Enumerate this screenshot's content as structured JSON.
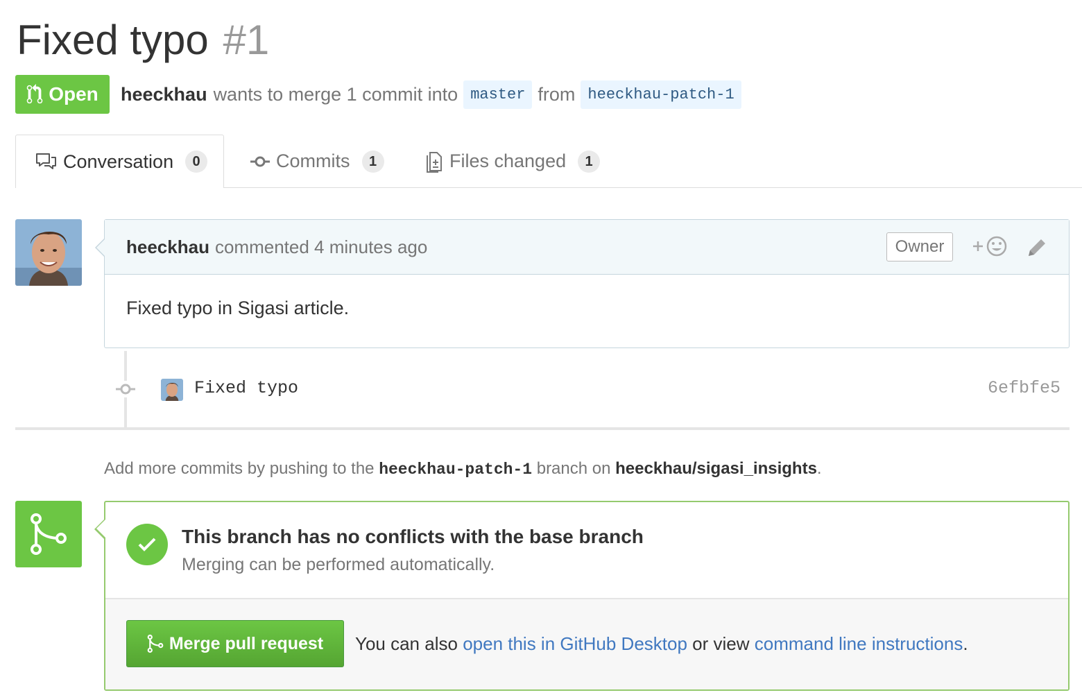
{
  "pr": {
    "title": "Fixed typo",
    "number": "#1",
    "state": "Open",
    "author": "heeckhau",
    "merge_text": "wants to merge 1 commit into",
    "base_branch": "master",
    "from_text": "from",
    "head_branch": "heeckhau-patch-1"
  },
  "tabs": [
    {
      "label": "Conversation",
      "count": "0",
      "icon": "comment-discussion-icon"
    },
    {
      "label": "Commits",
      "count": "1",
      "icon": "git-commit-icon"
    },
    {
      "label": "Files changed",
      "count": "1",
      "icon": "file-diff-icon"
    }
  ],
  "comment": {
    "author": "heeckhau",
    "action": "commented",
    "time": "4 minutes ago",
    "role_badge": "Owner",
    "body": "Fixed typo in Sigasi article."
  },
  "commits": [
    {
      "message": "Fixed typo",
      "sha": "6efbfe5"
    }
  ],
  "help": {
    "prefix": "Add more commits by pushing to the",
    "branch": "heeckhau-patch-1",
    "middle": "branch on",
    "repo": "heeckhau/sigasi_insights",
    "suffix": "."
  },
  "merge": {
    "title": "This branch has no conflicts with the base branch",
    "subtitle": "Merging can be performed automatically.",
    "button": "Merge pull request",
    "note_prefix": "You can also",
    "link_desktop": "open this in GitHub Desktop",
    "note_middle": "or view",
    "link_cli": "command line instructions",
    "note_suffix": "."
  },
  "colors": {
    "open_green": "#6cc644",
    "link_blue": "#4078c0",
    "branch_bg": "#eaf5ff"
  }
}
